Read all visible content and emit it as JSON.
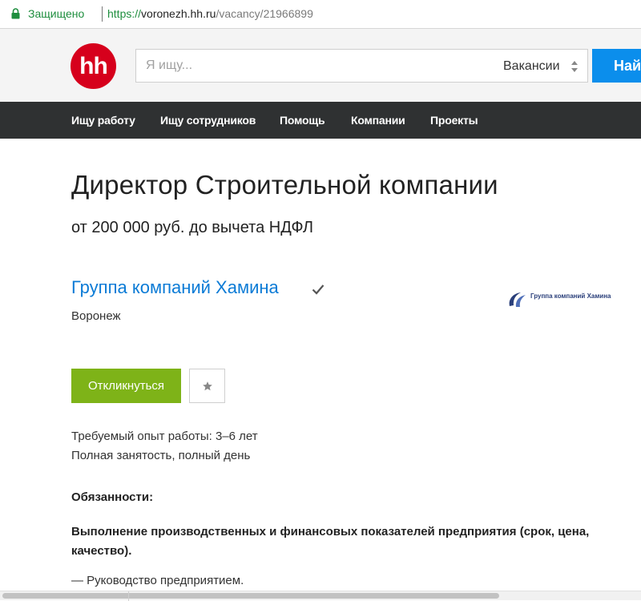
{
  "browser": {
    "secure_label": "Защищено",
    "url_scheme": "https://",
    "url_host": "voronezh.hh.ru",
    "url_path": "/vacancy/21966899"
  },
  "header": {
    "logo_text": "hh",
    "search_placeholder": "Я ищу...",
    "search_scope": "Вакансии",
    "search_button": "Найти",
    "brand_color": "#d6001c",
    "button_color": "#0b8eec"
  },
  "nav": {
    "items": [
      {
        "label": "Ищу работу"
      },
      {
        "label": "Ищу сотрудников"
      },
      {
        "label": "Помощь"
      },
      {
        "label": "Компании"
      },
      {
        "label": "Проекты"
      }
    ]
  },
  "vacancy": {
    "title": "Директор Строительной компании",
    "salary": "от 200 000 руб. до вычета НДФЛ",
    "company": "Группа компаний Хамина",
    "city": "Воронеж",
    "company_logo_text": "Группа компаний Хамина",
    "apply_button": "Откликнуться",
    "experience": "Требуемый опыт работы: 3–6 лет",
    "employment": "Полная занятость, полный день",
    "duties_title": "Обязанности:",
    "duties_lead": "Выполнение производственных и финансовых показателей предприятия (срок, цена, качество).",
    "duty_1": "— Руководство предприятием."
  },
  "icons": {
    "secure": "lock-icon",
    "verified": "checkmark-icon",
    "favorite": "star-icon",
    "scope": "select-arrows-icon"
  }
}
